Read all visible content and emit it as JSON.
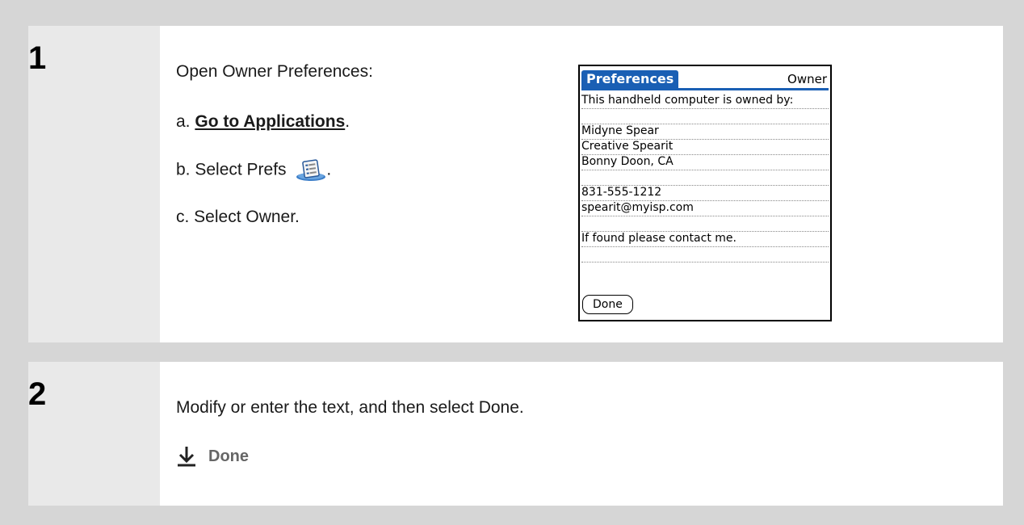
{
  "steps": [
    {
      "number": "1",
      "intro": "Open Owner Preferences:",
      "a_prefix": "a.",
      "a_link": "Go to Applications",
      "a_suffix": ".",
      "b_text": "b. Select Prefs",
      "b_suffix": ".",
      "c_text": "c. Select Owner."
    },
    {
      "number": "2",
      "instruction": "Modify or enter the text, and then select Done.",
      "done_label": "Done"
    }
  ],
  "palm_screen": {
    "tab_title": "Preferences",
    "panel_title": "Owner",
    "lines": [
      "This handheld computer is owned by:",
      "",
      "Midyne Spear",
      "Creative Spearit",
      "Bonny Doon, CA",
      "",
      "831-555-1212",
      "spearit@myisp.com",
      "",
      "If found please contact me.",
      ""
    ],
    "done_button": "Done",
    "accent_color": "#1a5fb4"
  },
  "icons": {
    "prefs": "prefs-icon",
    "done_arrow": "down-arrow-icon"
  }
}
